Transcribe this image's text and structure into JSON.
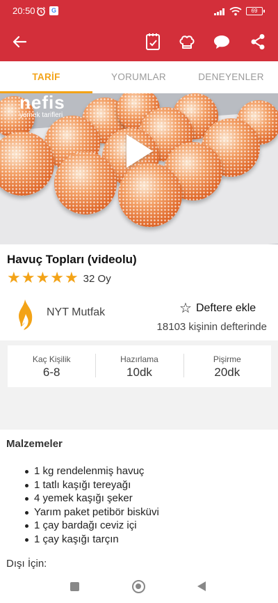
{
  "status_bar": {
    "time": "20:50",
    "battery": "69"
  },
  "toolbar": {
    "icons": [
      "back-arrow-icon",
      "notebook-icon",
      "chef-hat-icon",
      "chat-bubble-icon",
      "share-icon"
    ]
  },
  "tabs": [
    {
      "label": "TARİF",
      "active": true
    },
    {
      "label": "YORUMLAR",
      "active": false
    },
    {
      "label": "DENEYENLER",
      "active": false
    }
  ],
  "video": {
    "logo_main": "nefis",
    "logo_sub": "yemek tarifleri"
  },
  "recipe": {
    "title": "Havuç Topları (videolu)",
    "rating": 5,
    "vote_text": "32 Oy",
    "author": "NYT Mutfak",
    "add_to_book": "Deftere ekle",
    "book_count": "18103 kişinin defterinde"
  },
  "stats": [
    {
      "label": "Kaç Kişilik",
      "value": "6-8"
    },
    {
      "label": "Hazırlama",
      "value": "10dk"
    },
    {
      "label": "Pişirme",
      "value": "20dk"
    }
  ],
  "ingredients": {
    "title": "Malzemeler",
    "items": [
      "1 kg rendelenmiş havuç",
      "1 tatlı kaşığı tereyağı",
      "4 yemek kaşığı şeker",
      "Yarım paket petibör bisküvi",
      "1 çay bardağı ceviz içi",
      "1 çay kaşığı tarçın"
    ],
    "subsection": "Dışı İçin:"
  },
  "colors": {
    "primary": "#d32f3a",
    "accent": "#f3a317"
  }
}
